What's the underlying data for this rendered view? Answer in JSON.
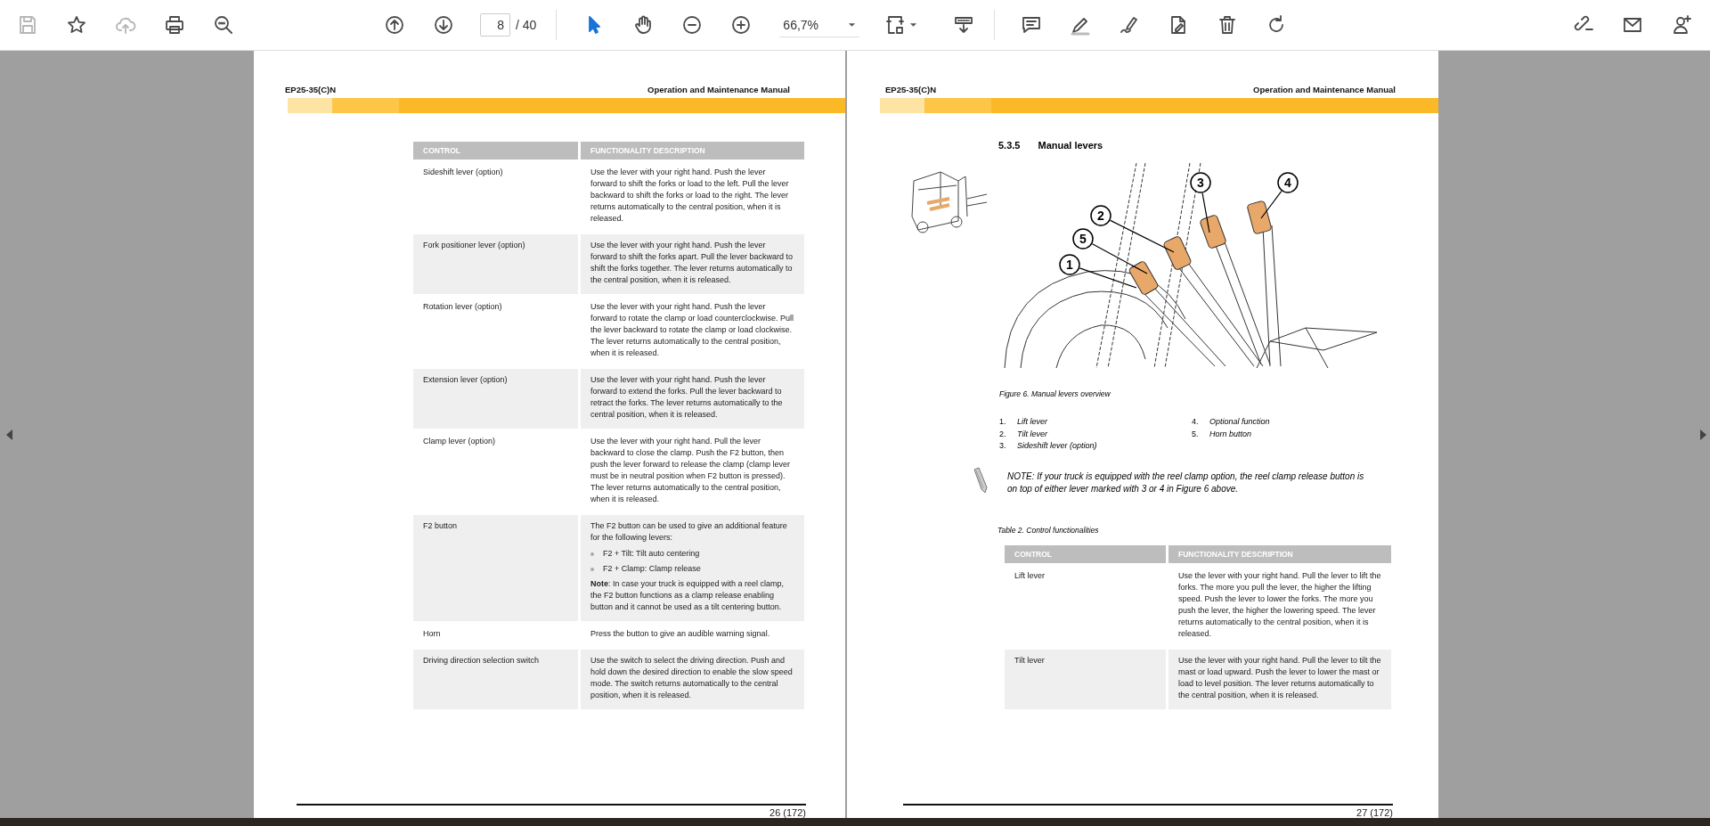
{
  "toolbar": {
    "file_tools": [
      {
        "disabled": true
      },
      {
        "disabled": false
      },
      {
        "disabled": true
      },
      {
        "disabled": false
      },
      {
        "disabled": false
      }
    ],
    "page_nav": {
      "current": "8",
      "total": "/ 40"
    },
    "mode_tools": [
      {
        "selected": true
      },
      {
        "selected": false
      }
    ],
    "zoom": {
      "value": "66,7%"
    }
  },
  "left_page": {
    "header_left": "EP25-35(C)N",
    "header_right": "Operation and Maintenance Manual",
    "table": {
      "columns": [
        "CONTROL",
        "FUNCTIONALITY DESCRIPTION"
      ],
      "rows": [
        {
          "control": "Sideshift lever (option)",
          "description": [
            {
              "kind": "paragraph",
              "text": "Use the lever with your right hand. Push the lever forward to shift the forks or load to the left. Pull the lever backward to shift the forks or load to the right. The lever returns automatically to the central position, when it is released."
            }
          ]
        },
        {
          "control": "Fork positioner lever (option)",
          "description": [
            {
              "kind": "paragraph",
              "text": "Use the lever with your right hand. Push the lever forward to shift the forks apart. Pull the lever backward to shift the forks together. The lever returns automatically to the central position, when it is released."
            }
          ]
        },
        {
          "control": "Rotation lever (option)",
          "description": [
            {
              "kind": "paragraph",
              "text": "Use the lever with your right hand. Push the lever forward to rotate the clamp or load counterclockwise. Pull the lever backward to rotate the clamp or load clockwise. The lever returns automatically to the central position, when it is released."
            }
          ]
        },
        {
          "control": "Extension lever (option)",
          "description": [
            {
              "kind": "paragraph",
              "text": "Use the lever with your right hand. Push the lever forward to extend the forks. Pull the lever backward to retract the forks. The lever returns automatically to the central position, when it is released."
            }
          ]
        },
        {
          "control": "Clamp lever (option)",
          "description": [
            {
              "kind": "paragraph",
              "text": "Use the lever with your right hand. Pull the lever backward to close the clamp. Push the F2 button, then push the lever forward to release the clamp (clamp lever must be in neutral position when F2 button is pressed). The lever returns automatically to the central position, when it is released."
            }
          ]
        },
        {
          "control": "F2 button",
          "description": [
            {
              "kind": "paragraph",
              "text": "The F2 button can be used to give an additional feature for the following levers:"
            },
            {
              "kind": "bullet",
              "text": "F2 + Tilt: Tilt auto centering"
            },
            {
              "kind": "bullet",
              "text": "F2 + Clamp: Clamp release"
            },
            {
              "kind": "paragraph",
              "text": "**Note**: In case your truck is equipped with a reel clamp, the F2 button functions as a clamp release enabling button and it cannot be used as a tilt centering button."
            }
          ]
        },
        {
          "control": "Horn",
          "description": [
            {
              "kind": "paragraph",
              "text": "Press the button to give an audible warning signal."
            }
          ]
        },
        {
          "control": "Driving direction selection switch",
          "description": [
            {
              "kind": "paragraph",
              "text": "Use the switch to select the driving direction. Push and hold down the desired direction to enable the slow speed mode. The switch returns automatically to the central position, when it is released."
            }
          ]
        }
      ]
    },
    "page_number": "26 (172)"
  },
  "right_page": {
    "header_left": "EP25-35(C)N",
    "header_right": "Operation and Maintenance Manual",
    "section_number": "5.3.5",
    "section_title": "Manual levers",
    "figure": {
      "callouts": [
        "1",
        "2",
        "3",
        "4",
        "5"
      ],
      "caption": "Figure 6. Manual levers overview"
    },
    "legend": [
      [
        {
          "number": "1.",
          "label": "Lift lever"
        },
        {
          "number": "2.",
          "label": "Tilt lever"
        },
        {
          "number": "3.",
          "label": "Sideshift lever (option)"
        }
      ],
      [
        {
          "number": "4.",
          "label": "Optional function"
        },
        {
          "number": "5.",
          "label": "Horn button"
        }
      ]
    ],
    "note": "NOTE: If your truck is equipped with the reel clamp option, the reel clamp release button is on top of either lever marked with 3 or 4 in Figure 6 above.",
    "table_title": "Table 2. Control functionalities",
    "table": {
      "columns": [
        "CONTROL",
        "FUNCTIONALITY DESCRIPTION"
      ],
      "rows": [
        {
          "control": "Lift lever",
          "description": [
            {
              "kind": "paragraph",
              "text": "Use the lever with your right hand. Pull the lever to lift the forks. The more you pull the lever, the higher the lifting speed. Push the lever to lower the forks. The more you push the lever, the higher the lowering speed. The lever returns automatically to the central position, when it is released."
            }
          ]
        },
        {
          "control": "Tilt lever",
          "description": [
            {
              "kind": "paragraph",
              "text": "Use the lever with your right hand. Pull the lever to tilt the mast or load upward. Push the lever to lower the mast or load to level position. The lever returns automatically to the central position, when it is released."
            }
          ]
        }
      ]
    },
    "page_number": "27 (172)"
  }
}
